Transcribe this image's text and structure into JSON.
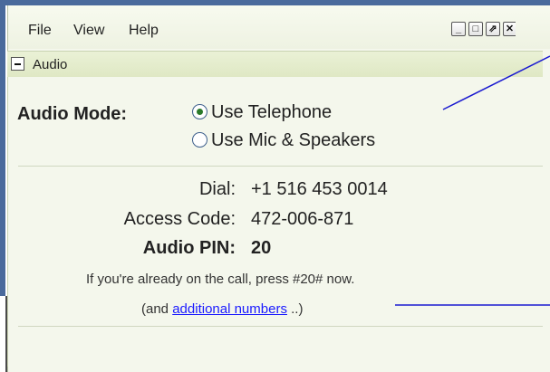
{
  "menu": {
    "file": "File",
    "view": "View",
    "help": "Help"
  },
  "window_controls": {
    "minimize": "_",
    "maximize": "□",
    "popout": "⇗",
    "close": "✕"
  },
  "panel": {
    "title": "Audio"
  },
  "audio_mode": {
    "label": "Audio Mode:",
    "options": [
      {
        "label": "Use Telephone",
        "selected": true
      },
      {
        "label": "Use Mic & Speakers",
        "selected": false
      }
    ]
  },
  "dial_info": {
    "dial_label": "Dial:",
    "dial_value": "+1 516 453 0014",
    "access_code_label": "Access Code:",
    "access_code_value": "472-006-871",
    "audio_pin_label": "Audio PIN:",
    "audio_pin_value": "20"
  },
  "note": {
    "already_on_call": "If you're already on the call, press #20# now.",
    "additional_prefix": "(and ",
    "additional_link": "additional numbers",
    "additional_suffix": " ..)"
  },
  "colors": {
    "frame": "#4a6a9c",
    "panel_background": "#f4f7ec",
    "radio_selected": "#2a7a2a",
    "link": "#1a1aff",
    "callout_line": "#1a1ad0"
  }
}
